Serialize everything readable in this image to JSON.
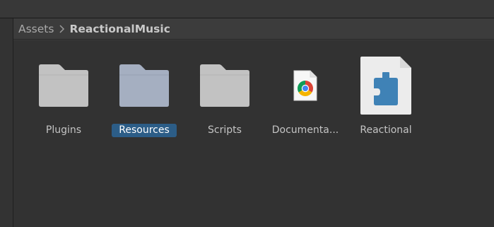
{
  "breadcrumb": {
    "items": [
      "Assets",
      "ReactionalMusic"
    ],
    "separator_icon": "chevron-right-icon"
  },
  "assets": [
    {
      "label": "Plugins",
      "icon": "folder-icon",
      "selected": false
    },
    {
      "label": "Resources",
      "icon": "folder-icon",
      "selected": true
    },
    {
      "label": "Scripts",
      "icon": "folder-icon",
      "selected": false
    },
    {
      "label": "Documenta...",
      "icon": "chrome-html-file-icon",
      "selected": false
    },
    {
      "label": "Reactional",
      "icon": "plugin-asset-icon",
      "selected": false
    }
  ],
  "colors": {
    "folder": "#c2c2c2",
    "folder_selected": "#a5afc1",
    "selection": "#2c5d87",
    "plugin_blue": "#3f82b6"
  }
}
